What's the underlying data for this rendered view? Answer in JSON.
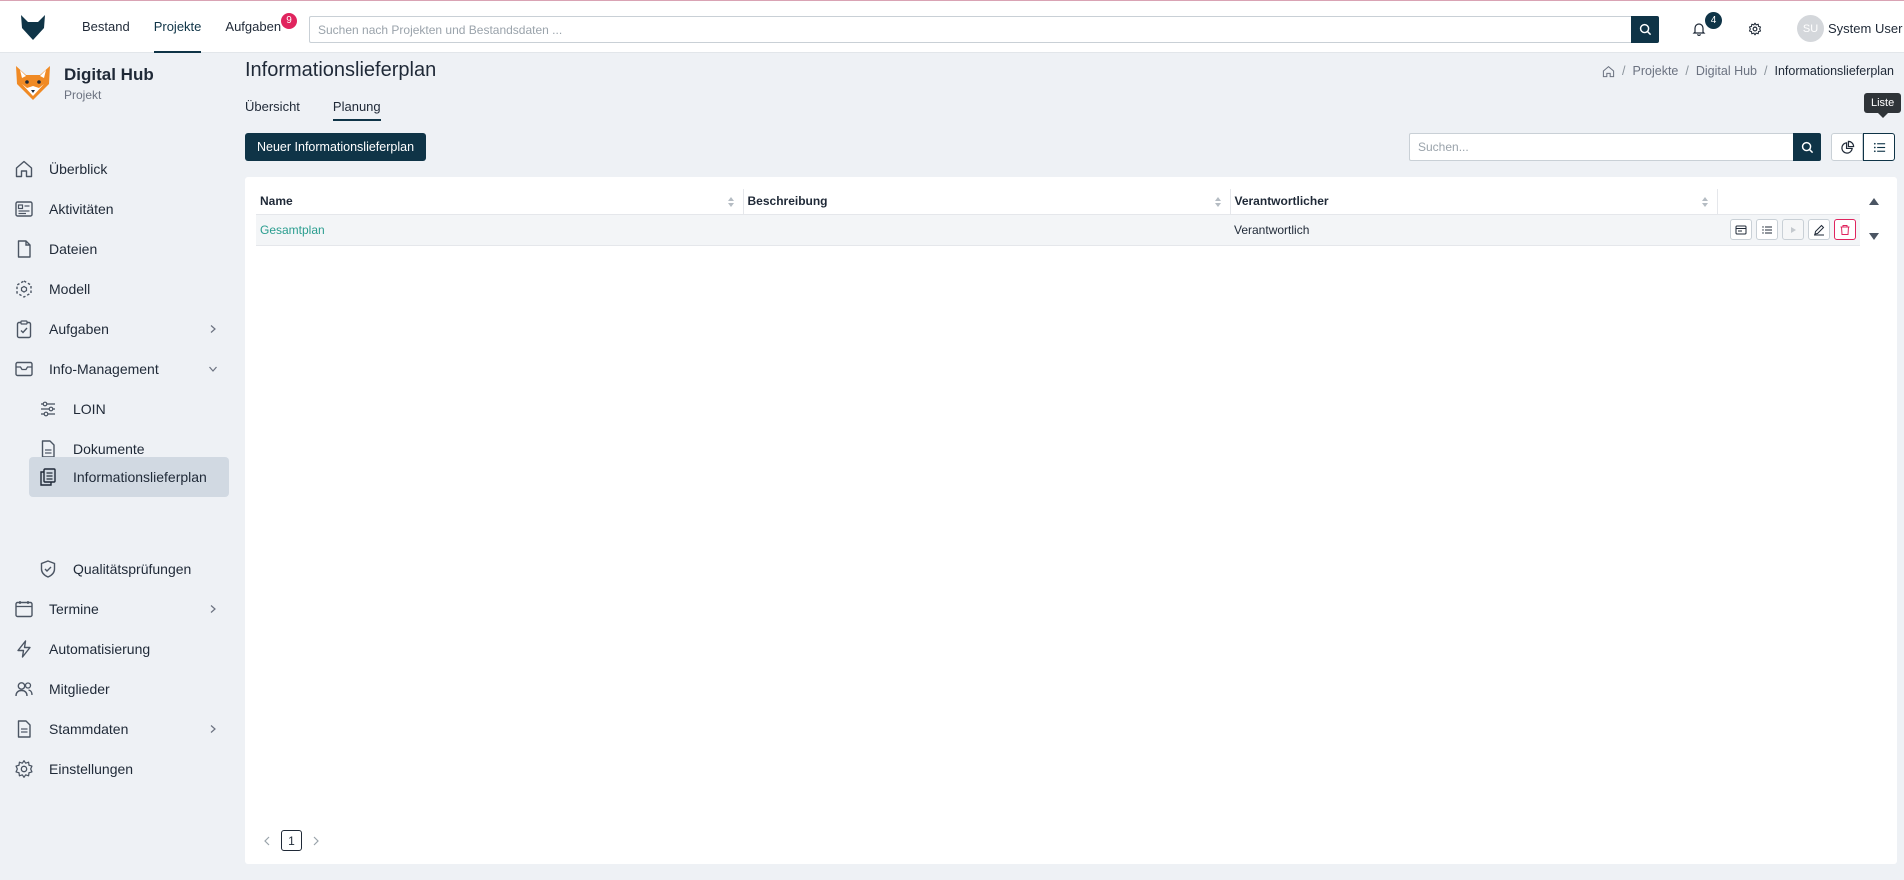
{
  "topnav": {
    "items": [
      {
        "label": "Bestand"
      },
      {
        "label": "Projekte"
      },
      {
        "label": "Aufgaben",
        "badge": "9"
      }
    ]
  },
  "search": {
    "placeholder": "Suchen nach Projekten und Bestandsdaten ..."
  },
  "notifications": {
    "count": "4"
  },
  "user": {
    "initials": "SU",
    "name": "System User"
  },
  "project": {
    "title": "Digital Hub",
    "subtitle": "Projekt"
  },
  "sidebar": {
    "items": [
      {
        "label": "Überblick",
        "icon": "home-icon"
      },
      {
        "label": "Aktivitäten",
        "icon": "activity-icon"
      },
      {
        "label": "Dateien",
        "icon": "file-icon"
      },
      {
        "label": "Modell",
        "icon": "model-icon"
      },
      {
        "label": "Aufgaben",
        "icon": "clipboard-check-icon"
      },
      {
        "label": "Info-Management",
        "icon": "inbox-icon"
      },
      {
        "label": "LOIN",
        "icon": "sliders-icon"
      },
      {
        "label": "Dokumente",
        "icon": "document-icon"
      },
      {
        "label": "Informationslieferplan",
        "icon": "copy-document-icon"
      },
      {
        "label": "Qualitätsprüfungen",
        "icon": "shield-check-icon"
      },
      {
        "label": "Termine",
        "icon": "calendar-icon"
      },
      {
        "label": "Automatisierung",
        "icon": "lightning-icon"
      },
      {
        "label": "Mitglieder",
        "icon": "users-icon"
      },
      {
        "label": "Stammdaten",
        "icon": "data-file-icon"
      },
      {
        "label": "Einstellungen",
        "icon": "gear-icon"
      }
    ]
  },
  "page": {
    "title": "Informationslieferplan"
  },
  "breadcrumb": {
    "items": [
      "Projekte",
      "Digital Hub",
      "Informationslieferplan"
    ]
  },
  "tabs": [
    {
      "label": "Übersicht"
    },
    {
      "label": "Planung"
    }
  ],
  "toolbar": {
    "new_label": "Neuer Informationslieferplan",
    "search_placeholder": "Suchen...",
    "tooltip": "Liste"
  },
  "table": {
    "columns": [
      "Name",
      "Beschreibung",
      "Verantwortlicher"
    ],
    "rows": [
      {
        "name": "Gesamtplan",
        "description": "",
        "responsible": "Verantwortlich"
      }
    ]
  },
  "pagination": {
    "current": "1"
  },
  "colors": {
    "primary": "#0f3447",
    "link": "#2a9d8f",
    "danger": "#e0245e",
    "active_nav": "#d1d9e2"
  }
}
